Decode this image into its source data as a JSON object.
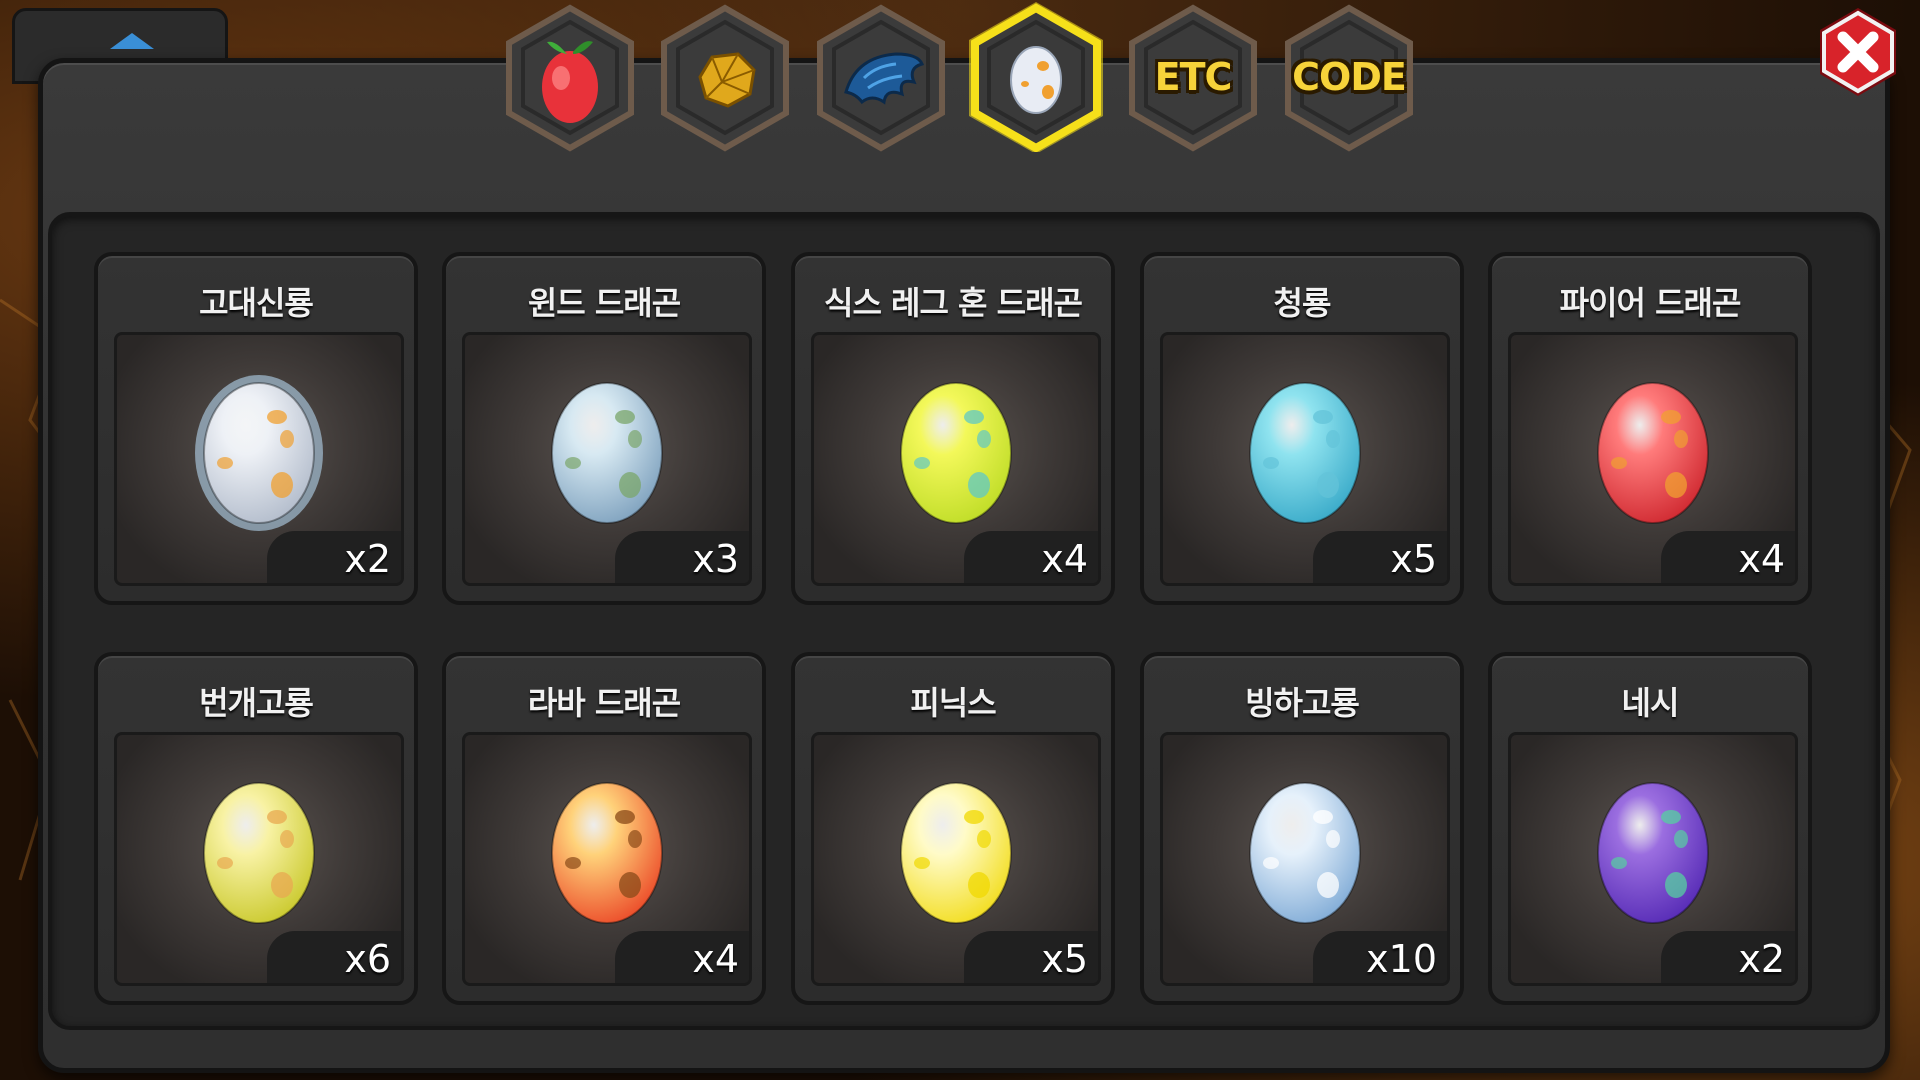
{
  "tabs": [
    {
      "id": "fruit",
      "icon": "fruit-icon",
      "label": "",
      "selected": false
    },
    {
      "id": "ore",
      "icon": "gold-ore-icon",
      "label": "",
      "selected": false
    },
    {
      "id": "scale",
      "icon": "dragon-scale-icon",
      "label": "",
      "selected": false
    },
    {
      "id": "egg",
      "icon": "egg-icon",
      "label": "",
      "selected": true
    },
    {
      "id": "etc",
      "icon": "",
      "label": "ETC",
      "selected": false
    },
    {
      "id": "code",
      "icon": "",
      "label": "CODE",
      "selected": false
    }
  ],
  "colors": {
    "selected_tab_border": "#f6e01a",
    "close_button": "#d8232a",
    "tab_text": "#f7d33a"
  },
  "close_icon": "close-icon",
  "items": [
    {
      "name": "고대신룡",
      "count": "x2",
      "egg_base": "#eef1f6",
      "egg_dark": "#a8b3c4",
      "spot": "#f0a030",
      "glow": true
    },
    {
      "name": "윈드 드래곤",
      "count": "x3",
      "egg_base": "#d7e9f2",
      "egg_dark": "#6f95b5",
      "spot": "#7aa56a",
      "glow": false
    },
    {
      "name": "식스 레그 혼 드래곤",
      "count": "x4",
      "egg_base": "#f3f85a",
      "egg_dark": "#b6d81e",
      "spot": "#5fc8c6",
      "glow": false
    },
    {
      "name": "청룡",
      "count": "x5",
      "egg_base": "#8fe3ef",
      "egg_dark": "#2aa0c2",
      "spot": "#63c3d8",
      "glow": false
    },
    {
      "name": "파이어 드래곤",
      "count": "x4",
      "egg_base": "#ff7b7b",
      "egg_dark": "#c71a23",
      "spot": "#f0a030",
      "glow": false
    },
    {
      "name": "번개고룡",
      "count": "x6",
      "egg_base": "#f8f2a4",
      "egg_dark": "#c2c218",
      "spot": "#e8a850",
      "glow": false
    },
    {
      "name": "라바 드래곤",
      "count": "x4",
      "egg_base": "#ffd27a",
      "egg_dark": "#e8321a",
      "spot": "#8a4a18",
      "glow": false
    },
    {
      "name": "피닉스",
      "count": "x5",
      "egg_base": "#fffbc8",
      "egg_dark": "#f0d800",
      "spot": "#f0d800",
      "glow": false
    },
    {
      "name": "빙하고룡",
      "count": "x10",
      "egg_base": "#e6f1fb",
      "egg_dark": "#6e9fd0",
      "spot": "#ffffff",
      "glow": false
    },
    {
      "name": "네시",
      "count": "x2",
      "egg_base": "#9b6ee0",
      "egg_dark": "#4a1fae",
      "spot": "#56d0a0",
      "glow": false
    }
  ]
}
